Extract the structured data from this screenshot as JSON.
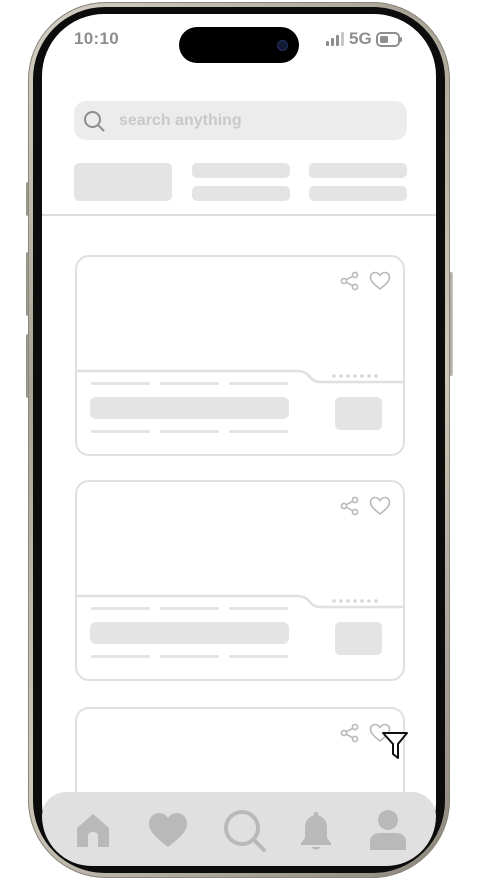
{
  "status_bar": {
    "time": "10:10",
    "network": "5G"
  },
  "search": {
    "placeholder": "search anything"
  },
  "colors": {
    "wireframe_fill": "#e4e4e4",
    "wireframe_stroke": "#e0e0e0",
    "icon_gray": "#b9b9b9",
    "nav_background": "#e0e0e0"
  },
  "cards": [
    {
      "actions": [
        "share-icon",
        "heart-icon"
      ]
    },
    {
      "actions": [
        "share-icon",
        "heart-icon"
      ]
    },
    {
      "actions": [
        "share-icon",
        "heart-icon"
      ]
    }
  ],
  "bottom_nav": {
    "items": [
      "home-icon",
      "heart-icon",
      "search-icon",
      "bell-icon",
      "profile-icon"
    ]
  },
  "floating": {
    "icon": "filter-icon"
  }
}
